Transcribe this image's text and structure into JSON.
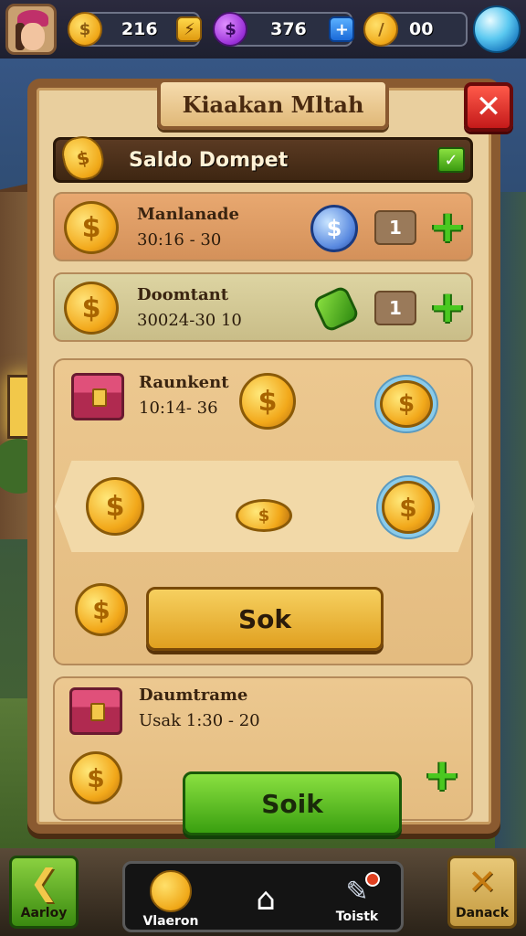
{
  "colors": {
    "panel_bg": "#e9cf9e",
    "panel_border": "#8a5a30",
    "accent_gold": "#f0a818",
    "accent_green": "#4ac820",
    "close_red": "#c41a1a"
  },
  "topbar": {
    "resource_1": {
      "value": "216",
      "icon": "gold-coin-icon"
    },
    "resource_2": {
      "value": "376",
      "icon": "purple-gem-icon"
    },
    "resource_3": {
      "value": "00",
      "icon": "gold-coin-icon"
    },
    "orb_icon": "blue-orb-icon"
  },
  "panel": {
    "title": "Kiaakan Mltah",
    "close_glyph": "✕",
    "wallet_label": "Saldo Dompet",
    "wallet_check_glyph": "✓"
  },
  "rows": [
    {
      "name": "Manlanade",
      "sub": "30:16 - 30",
      "qty": "1",
      "badge": "blue-coin-icon"
    },
    {
      "name": "Doomtant",
      "sub": "30024-30  10",
      "qty": "1",
      "badge": "green-ticket-icon"
    }
  ],
  "big_card": {
    "name": "Raunkent",
    "sub": "10:14- 36",
    "button_label": "Sok"
  },
  "card_3": {
    "name": "Daumtrame",
    "sub": "Usak 1:30 - 20",
    "button_label": "Soik"
  },
  "nav": {
    "back_label": "Aarloy",
    "back_glyph": "❮",
    "center_items": [
      {
        "label": "Vlaeron",
        "icon": "coin-icon"
      },
      {
        "label": "",
        "icon": "home-icon",
        "glyph": "⌂"
      },
      {
        "label": "Toistk",
        "icon": "tools-icon",
        "glyph": "✎"
      }
    ],
    "close_label": "Danack",
    "close_glyph": "✕"
  }
}
